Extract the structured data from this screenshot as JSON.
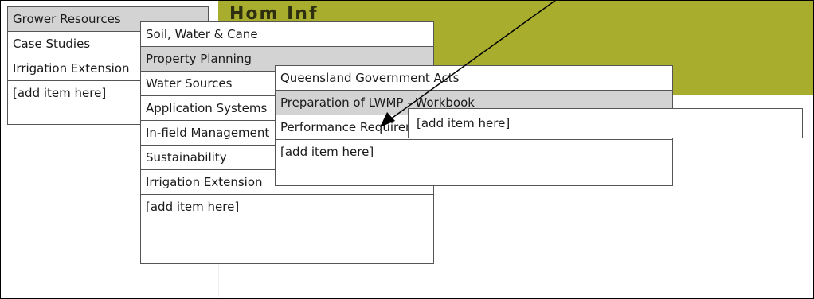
{
  "header": {
    "title": "Hom Inf"
  },
  "menus": {
    "level1": {
      "items": [
        {
          "label": "Grower Resources"
        },
        {
          "label": "Case Studies"
        },
        {
          "label": "Irrigation Extension"
        },
        {
          "label": "[add item here]"
        }
      ]
    },
    "level2": {
      "items": [
        {
          "label": "Soil, Water & Cane"
        },
        {
          "label": "Property Planning"
        },
        {
          "label": "Water Sources"
        },
        {
          "label": "Application Systems"
        },
        {
          "label": "In-field Management"
        },
        {
          "label": "Sustainability"
        },
        {
          "label": "Irrigation Extension"
        },
        {
          "label": "[add item here]"
        }
      ]
    },
    "level3": {
      "items": [
        {
          "label": "Queensland Government Acts"
        },
        {
          "label": "Preparation of LWMP - Workbook"
        },
        {
          "label": "Performance Requirements - LWMP"
        },
        {
          "label": "[add item here]"
        }
      ]
    },
    "level4": {
      "items": [
        {
          "label": "[add item here]"
        }
      ]
    }
  },
  "colors": {
    "header_band": "#a8ad2e",
    "highlight": "#d3d3d3"
  },
  "icons": [
    "annotation-arrow"
  ]
}
